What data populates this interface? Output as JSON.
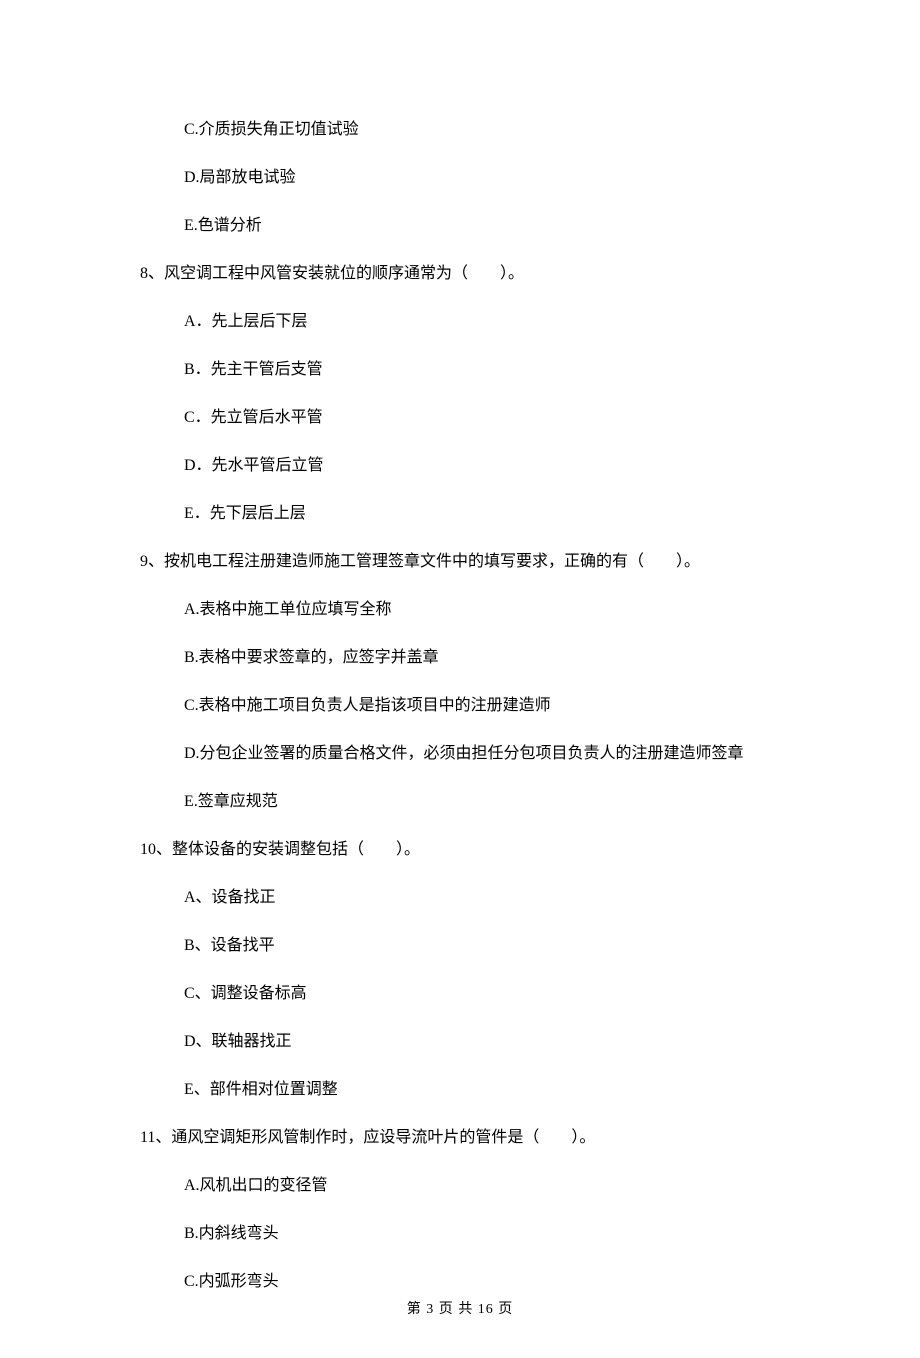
{
  "options_pre": [
    "C.介质损失角正切值试验",
    "D.局部放电试验",
    "E.色谱分析"
  ],
  "questions": [
    {
      "stem": "8、风空调工程中风管安装就位的顺序通常为（　　）。",
      "options": [
        "A．先上层后下层",
        "B．先主干管后支管",
        "C．先立管后水平管",
        "D．先水平管后立管",
        "E．先下层后上层"
      ]
    },
    {
      "stem": "9、按机电工程注册建造师施工管理签章文件中的填写要求，正确的有（　　）。",
      "options": [
        "A.表格中施工单位应填写全称",
        "B.表格中要求签章的，应签字并盖章",
        "C.表格中施工项目负责人是指该项目中的注册建造师",
        "D.分包企业签署的质量合格文件，必须由担任分包项目负责人的注册建造师签章",
        "E.签章应规范"
      ]
    },
    {
      "stem": "10、整体设备的安装调整包括（　　）。",
      "options": [
        "A、设备找正",
        "B、设备找平",
        "C、调整设备标高",
        "D、联轴器找正",
        "E、部件相对位置调整"
      ]
    },
    {
      "stem": "11、通风空调矩形风管制作时，应设导流叶片的管件是（　　）。",
      "options": [
        "A.风机出口的变径管",
        "B.内斜线弯头",
        "C.内弧形弯头"
      ]
    }
  ],
  "footer": "第 3 页 共 16 页"
}
